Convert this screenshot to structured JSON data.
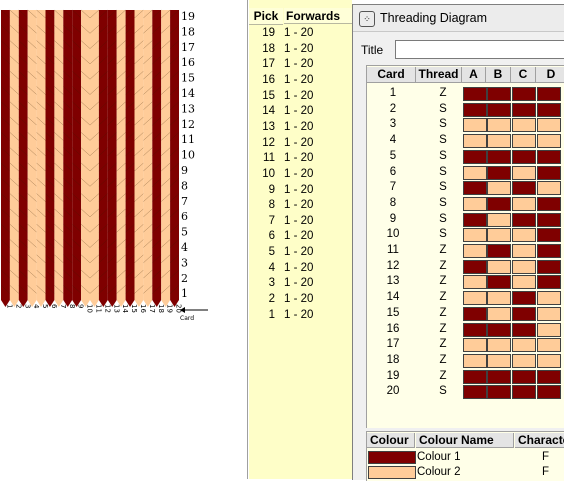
{
  "colors": {
    "colour1": "#7f0000",
    "colour2": "#ffcc99",
    "bg": "#ffffff",
    "pick_bg": "#fefec8"
  },
  "weave": {
    "pick_labels": [
      "19",
      "18",
      "17",
      "16",
      "15",
      "14",
      "13",
      "12",
      "11",
      "10",
      "9",
      "8",
      "7",
      "6",
      "5",
      "4",
      "3",
      "2",
      "1"
    ],
    "card_labels": [
      "1",
      "2",
      "3",
      "4",
      "5",
      "6",
      "7",
      "8",
      "9",
      "10",
      "11",
      "12",
      "13",
      "14",
      "15",
      "16",
      "17",
      "18",
      "19",
      "20"
    ],
    "card_axis_label": "Card",
    "column_colors": [
      1,
      2,
      1,
      2,
      2,
      1,
      2,
      1,
      1,
      2,
      2,
      1,
      1,
      2,
      1,
      2,
      2,
      1,
      2,
      1
    ]
  },
  "picks": {
    "header_pick": "Pick",
    "header_dir": "Forwards",
    "rows": [
      {
        "pick": "19",
        "range": "1 - 20"
      },
      {
        "pick": "18",
        "range": "1 - 20"
      },
      {
        "pick": "17",
        "range": "1 - 20"
      },
      {
        "pick": "16",
        "range": "1 - 20"
      },
      {
        "pick": "15",
        "range": "1 - 20"
      },
      {
        "pick": "14",
        "range": "1 - 20"
      },
      {
        "pick": "13",
        "range": "1 - 20"
      },
      {
        "pick": "12",
        "range": "1 - 20"
      },
      {
        "pick": "11",
        "range": "1 - 20"
      },
      {
        "pick": "10",
        "range": "1 - 20"
      },
      {
        "pick": "9",
        "range": "1 - 20"
      },
      {
        "pick": "8",
        "range": "1 - 20"
      },
      {
        "pick": "7",
        "range": "1 - 20"
      },
      {
        "pick": "6",
        "range": "1 - 20"
      },
      {
        "pick": "5",
        "range": "1 - 20"
      },
      {
        "pick": "4",
        "range": "1 - 20"
      },
      {
        "pick": "3",
        "range": "1 - 20"
      },
      {
        "pick": "2",
        "range": "1 - 20"
      },
      {
        "pick": "1",
        "range": "1 - 20"
      }
    ]
  },
  "dialog": {
    "title": "Threading Diagram",
    "title_label": "Title",
    "title_value": "",
    "headers": {
      "card": "Card",
      "thread": "Thread",
      "a": "A",
      "b": "B",
      "c": "C",
      "d": "D"
    },
    "rows": [
      {
        "card": "1",
        "thread": "Z",
        "holes": [
          1,
          1,
          1,
          1
        ]
      },
      {
        "card": "2",
        "thread": "S",
        "holes": [
          1,
          1,
          1,
          1
        ]
      },
      {
        "card": "3",
        "thread": "S",
        "holes": [
          2,
          2,
          2,
          2
        ]
      },
      {
        "card": "4",
        "thread": "S",
        "holes": [
          2,
          2,
          2,
          2
        ]
      },
      {
        "card": "5",
        "thread": "S",
        "holes": [
          1,
          1,
          1,
          1
        ]
      },
      {
        "card": "6",
        "thread": "S",
        "holes": [
          2,
          1,
          2,
          1
        ]
      },
      {
        "card": "7",
        "thread": "S",
        "holes": [
          1,
          2,
          1,
          2
        ]
      },
      {
        "card": "8",
        "thread": "S",
        "holes": [
          2,
          1,
          2,
          1
        ]
      },
      {
        "card": "9",
        "thread": "S",
        "holes": [
          1,
          2,
          1,
          1
        ]
      },
      {
        "card": "10",
        "thread": "S",
        "holes": [
          2,
          2,
          2,
          1
        ]
      },
      {
        "card": "11",
        "thread": "Z",
        "holes": [
          2,
          1,
          2,
          1
        ]
      },
      {
        "card": "12",
        "thread": "Z",
        "holes": [
          1,
          2,
          2,
          1
        ]
      },
      {
        "card": "13",
        "thread": "Z",
        "holes": [
          2,
          1,
          2,
          1
        ]
      },
      {
        "card": "14",
        "thread": "Z",
        "holes": [
          2,
          2,
          1,
          2
        ]
      },
      {
        "card": "15",
        "thread": "Z",
        "holes": [
          1,
          2,
          1,
          2
        ]
      },
      {
        "card": "16",
        "thread": "Z",
        "holes": [
          1,
          1,
          1,
          2
        ]
      },
      {
        "card": "17",
        "thread": "Z",
        "holes": [
          2,
          2,
          2,
          2
        ]
      },
      {
        "card": "18",
        "thread": "Z",
        "holes": [
          2,
          2,
          2,
          2
        ]
      },
      {
        "card": "19",
        "thread": "Z",
        "holes": [
          1,
          1,
          1,
          1
        ]
      },
      {
        "card": "20",
        "thread": "S",
        "holes": [
          1,
          1,
          1,
          1
        ]
      }
    ],
    "colour_table": {
      "headers": {
        "colour": "Colour",
        "name": "Colour Name",
        "char": "Characte"
      },
      "rows": [
        {
          "name": "Colour 1",
          "char": "F",
          "key": "colour1"
        },
        {
          "name": "Colour 2",
          "char": "F",
          "key": "colour2"
        }
      ]
    }
  }
}
